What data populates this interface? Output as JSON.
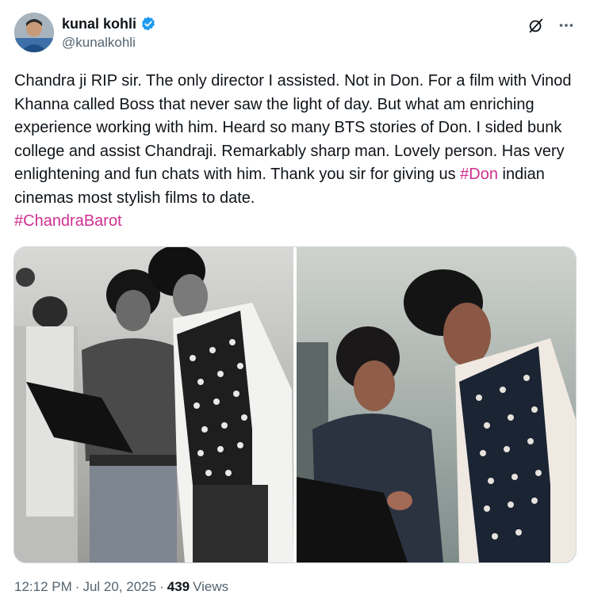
{
  "author": {
    "display_name": "kunal kohli",
    "handle": "@kunalkohli",
    "verified_color": "#1d9bf0"
  },
  "actions": {
    "grok_icon": "grok-icon",
    "more_icon": "more-icon"
  },
  "tweet": {
    "segments": [
      "Chandra ji RIP sir. The only director I assisted. Not in Don. For a film with Vinod Khanna called Boss that never saw the light of day. But what am enriching experience working with him. Heard so many BTS stories of Don. I sided bunk college and assist Chandraji. Remarkably sharp man. Lovely person. Has very enlightening and fun chats with him. Thank you sir for giving us ",
      "#Don",
      " indian cinemas most stylish films to date.",
      "#ChandraBarot"
    ],
    "hashtag_color": "#d02f8f"
  },
  "meta": {
    "time": "12:12 PM",
    "sep1": "·",
    "date": "Jul 20, 2025",
    "sep2": "·",
    "views_count": "439",
    "views_label": "Views"
  }
}
